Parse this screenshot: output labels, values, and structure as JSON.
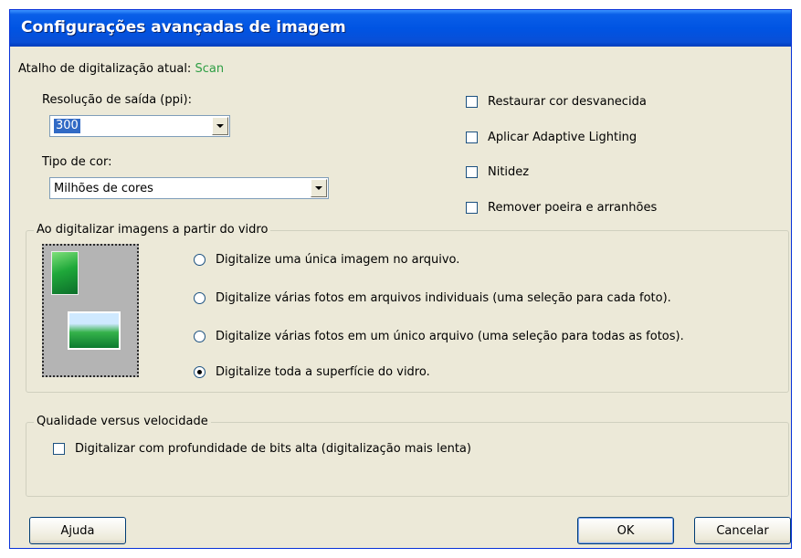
{
  "window": {
    "title": "Configurações avançadas de imagem"
  },
  "shortcut": {
    "label": "Atalho de digitalização atual:",
    "value": "Scan"
  },
  "resolution": {
    "label": "Resolução de saída (ppi):",
    "value": "300"
  },
  "color_type": {
    "label": "Tipo de cor:",
    "value": "Milhões de cores"
  },
  "options": [
    {
      "label": "Restaurar cor desvanecida",
      "checked": false
    },
    {
      "label": "Aplicar Adaptive Lighting",
      "checked": false
    },
    {
      "label": "Nitidez",
      "checked": false
    },
    {
      "label": "Remover poeira e arranhões",
      "checked": false
    }
  ],
  "glass_group": {
    "legend": "Ao digitalizar imagens a partir do vidro",
    "choices": [
      {
        "label": "Digitalize uma única imagem no arquivo.",
        "selected": false
      },
      {
        "label": "Digitalize várias fotos em arquivos individuais (uma seleção para cada foto).",
        "selected": false
      },
      {
        "label": "Digitalize várias fotos em um único arquivo (uma seleção para todas as fotos).",
        "selected": false
      },
      {
        "label": "Digitalize toda a superfície do vidro.",
        "selected": true
      }
    ]
  },
  "quality_group": {
    "legend": "Qualidade versus velocidade",
    "high_bit_depth": {
      "label": "Digitalizar com profundidade de bits alta (digitalização mais lenta)",
      "checked": false
    }
  },
  "buttons": {
    "help": "Ajuda",
    "ok": "OK",
    "cancel": "Cancelar"
  }
}
